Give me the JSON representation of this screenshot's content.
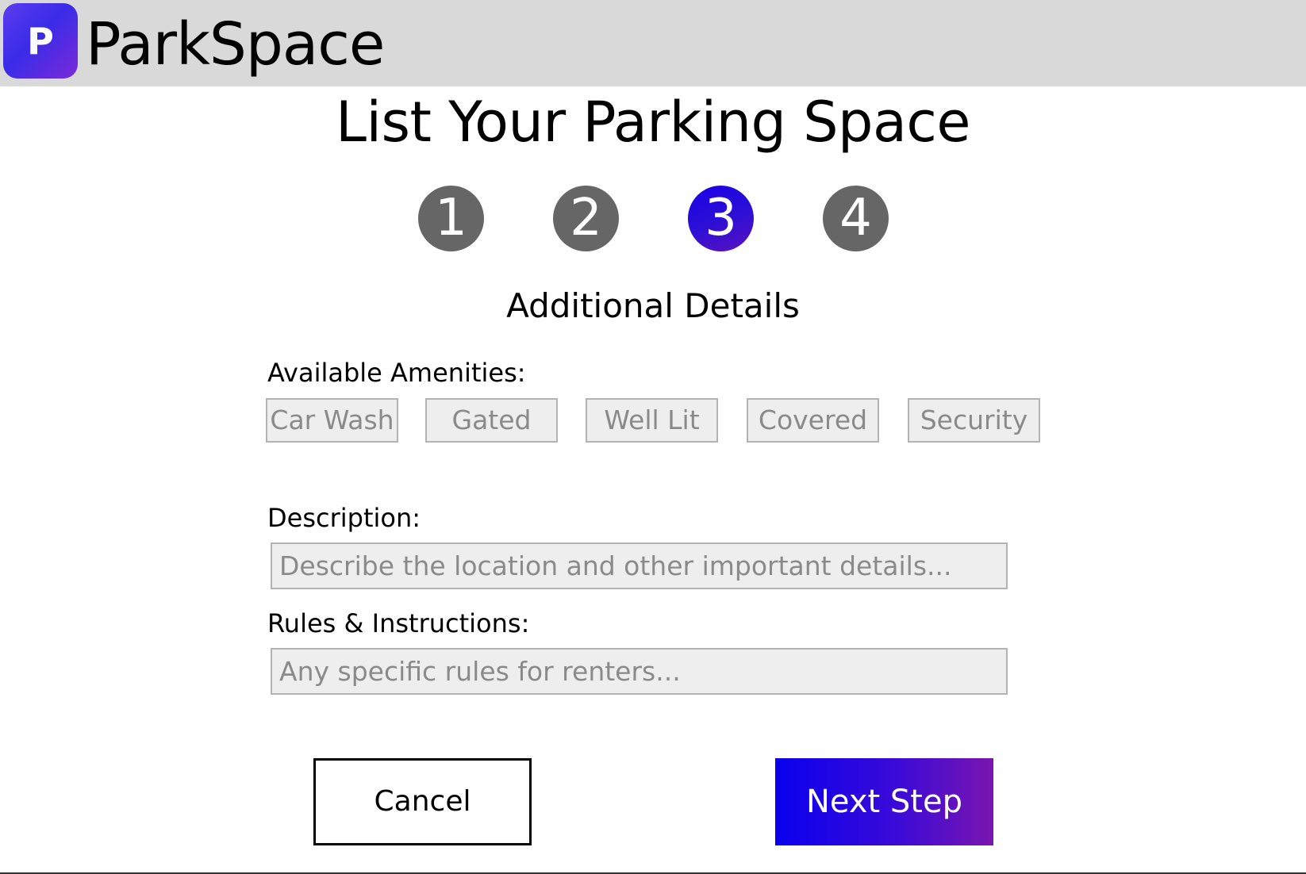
{
  "header": {
    "logo_letter": "P",
    "app_name": "ParkSpace"
  },
  "page": {
    "title": "List Your Parking Space",
    "section_title": "Additional Details"
  },
  "steps": {
    "items": [
      "1",
      "2",
      "3",
      "4"
    ],
    "active_index": 2,
    "colors": {
      "inactive": "#666666",
      "active": "#2b0fd6"
    }
  },
  "amenities": {
    "label": "Available Amenities:",
    "options": [
      "Car Wash",
      "Gated",
      "Well Lit",
      "Covered",
      "Security"
    ]
  },
  "description": {
    "label": "Description:",
    "value": "",
    "placeholder": "Describe the location and other important details..."
  },
  "rules": {
    "label": "Rules & Instructions:",
    "value": "",
    "placeholder": "Any specific rules for renters..."
  },
  "actions": {
    "cancel_label": "Cancel",
    "next_label": "Next Step"
  }
}
